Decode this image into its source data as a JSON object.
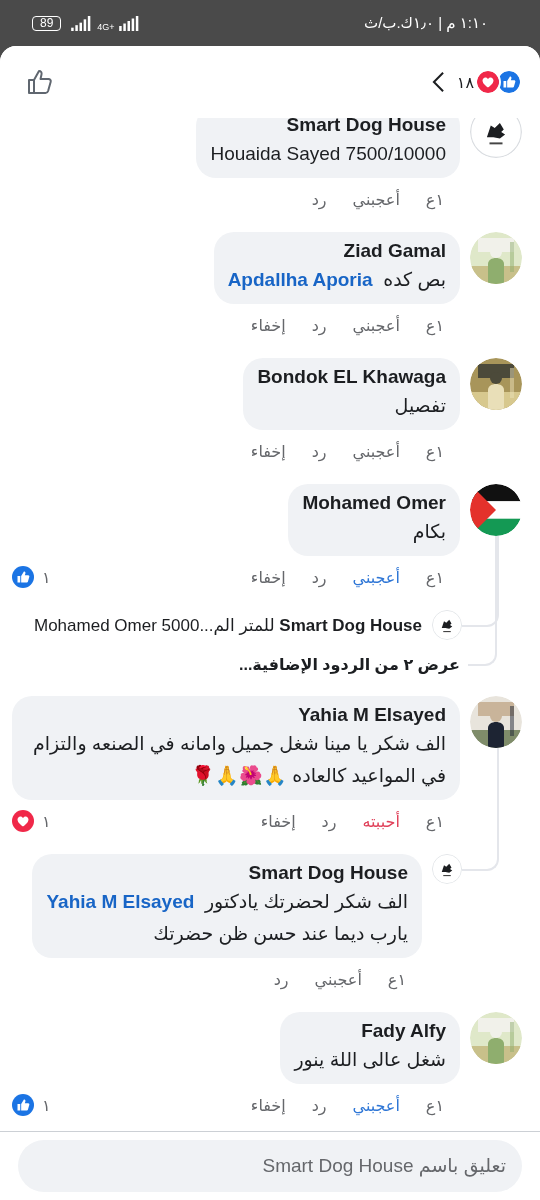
{
  "status_bar": {
    "time": "١:١٠ م | ١٫٠ك.ب/ث",
    "network": "4G+",
    "battery": "89"
  },
  "header": {
    "reactions": [
      {
        "kind": "like"
      },
      {
        "kind": "love"
      }
    ],
    "reaction_count": "١٨"
  },
  "comments": [
    {
      "author": "Smart Dog House",
      "avatar": {
        "kind": "logo"
      },
      "text": "Houaida Sayed 7500/10000",
      "time": "١ع",
      "like_label": "أعجبني",
      "liked": false,
      "loved": false,
      "reply_label": "رد"
    },
    {
      "author": "Ziad Gamal",
      "avatar": {
        "kind": "picture"
      },
      "text": "بص كده",
      "mention": "Apdallha Aporia",
      "time": "١ع",
      "like_label": "أعجبني",
      "liked": false,
      "loved": false,
      "reply_label": "رد",
      "hide_label": "إخفاء"
    },
    {
      "author": "Bondok EL Khawaga",
      "avatar": {
        "kind": "picture"
      },
      "text": "تفصيل",
      "time": "١ع",
      "like_label": "أعجبني",
      "liked": false,
      "loved": false,
      "reply_label": "رد",
      "hide_label": "إخفاء"
    },
    {
      "author": "Mohamed Omer",
      "avatar": {
        "kind": "flag"
      },
      "text": "بكام",
      "time": "١ع",
      "like_label": "أعجبني",
      "liked": true,
      "loved": false,
      "reply_label": "رد",
      "hide_label": "إخفاء",
      "count": "١",
      "count_icon": {
        "kind": "like"
      },
      "replies": [
        {
          "kind": "preview",
          "author": "Smart Dog House",
          "avatar": {
            "kind": "logo"
          },
          "text": "للمتر الم...Mohamed Omer 5000"
        },
        {
          "kind": "more",
          "text": "عرض ٢ من الردود الإضافية..."
        }
      ]
    },
    {
      "author": "Yahia M Elsayed",
      "avatar": {
        "kind": "picture"
      },
      "text": "الف شكر يا مينا شغل جميل وامانه في الصنعه والتزام في المواعيد كالعاده 🙏🌺🙏🌹",
      "time": "١ع",
      "like_label": "أحببته",
      "liked": false,
      "loved": true,
      "reply_label": "رد",
      "hide_label": "إخفاء",
      "count": "١",
      "count_icon": {
        "kind": "love"
      },
      "replies": [
        {
          "kind": "comment",
          "author": "Smart Dog House",
          "avatar": {
            "kind": "logo"
          },
          "text": "الف شكر لحضرتك يادكتور",
          "mention": "Yahia M Elsayed",
          "text_after": "يارب ديما عند حسن ظن حضرتك",
          "time": "١ع",
          "like_label": "أعجبني",
          "liked": false,
          "loved": false,
          "reply_label": "رد"
        }
      ]
    },
    {
      "author": "Fady Alfy",
      "avatar": {
        "kind": "picture"
      },
      "text": "شغل عالى اللة ينور",
      "time": "١ع",
      "like_label": "أعجبني",
      "liked": true,
      "loved": false,
      "reply_label": "رد",
      "hide_label": "إخفاء",
      "count": "١",
      "count_icon": {
        "kind": "like"
      }
    }
  ],
  "composer": {
    "placeholder": "تعليق باسم Smart Dog House"
  }
}
